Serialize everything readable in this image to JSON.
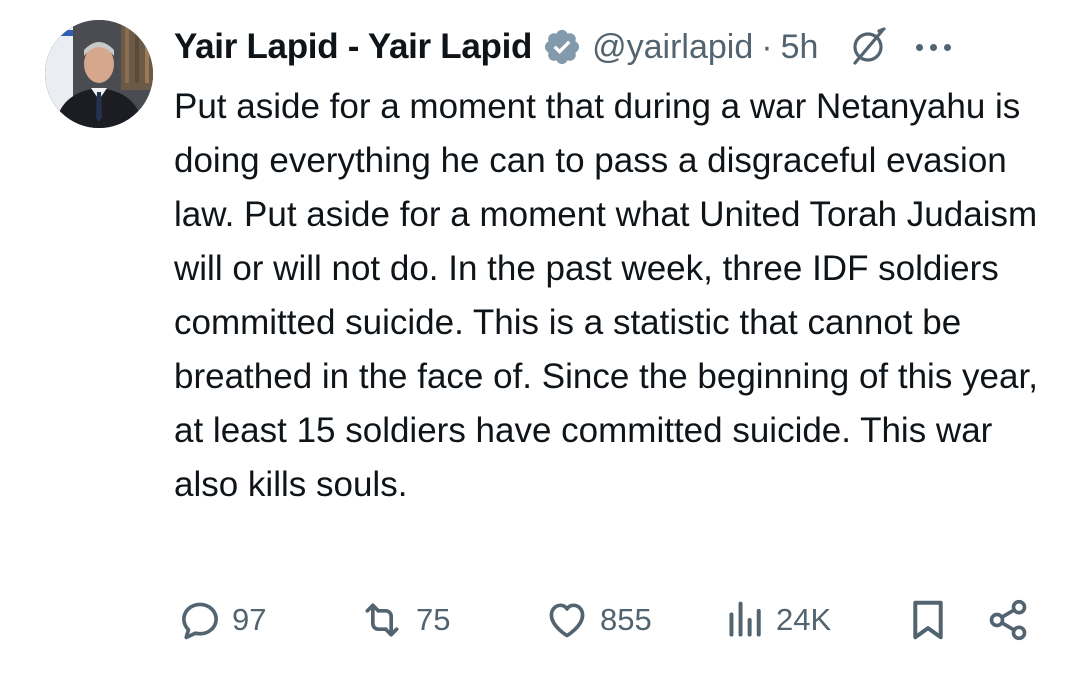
{
  "tweet": {
    "author_name": "Yair Lapid - Yair Lapid",
    "handle": "@yairlapid",
    "separator": "·",
    "time": "5h",
    "text": "Put aside for a moment that during a war Netanyahu is doing everything he can to pass a disgraceful evasion law. Put aside for a moment what United Torah Judaism will or will not do. In the past week, three IDF soldiers committed suicide. This is a statistic that cannot be breathed in the face of. Since the beginning of this year, at least 15 soldiers have committed suicide. This war also kills souls."
  },
  "actions": {
    "replies": "97",
    "reposts": "75",
    "likes": "855",
    "views": "24K"
  },
  "icons": {
    "verified": "verified-badge-icon",
    "grok": "grok-icon",
    "more": "more-icon",
    "reply": "reply-icon",
    "repost": "repost-icon",
    "like": "heart-icon",
    "views": "views-icon",
    "bookmark": "bookmark-icon",
    "share": "share-icon"
  },
  "colors": {
    "text": "#0f1419",
    "secondary": "#536471",
    "verified_badge": "#829aab"
  }
}
